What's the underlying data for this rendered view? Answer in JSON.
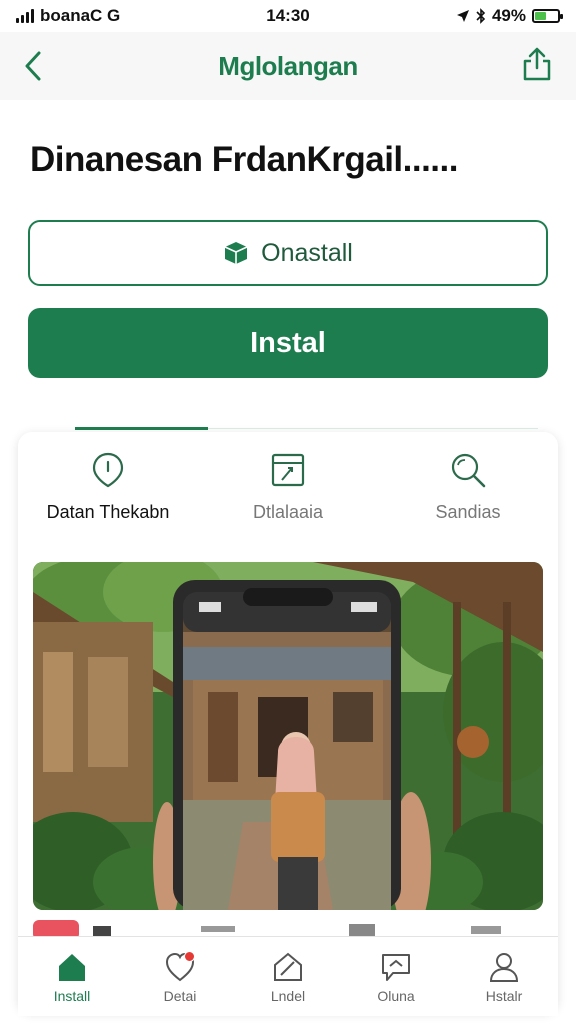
{
  "status_bar": {
    "carrier": "boanaC G",
    "time": "14:30",
    "battery_text": "49%",
    "battery_level": 0.49,
    "battery_color": "#4cc04a"
  },
  "header": {
    "app_name": "Mglolangan",
    "back_icon": "chevron-left-icon",
    "share_icon": "share-icon"
  },
  "page": {
    "title": "Dinanesan FrdanKrgail......"
  },
  "actions": {
    "secondary_label": "Onastall",
    "secondary_icon": "box-icon",
    "primary_label": "Instal"
  },
  "tabs": [
    {
      "label": "Datan Thekabn",
      "icon": "location-pin-icon",
      "active": true
    },
    {
      "label": "Dtlalaaia",
      "icon": "notebook-icon",
      "active": false
    },
    {
      "label": "Sandias",
      "icon": "search-icon",
      "active": false
    }
  ],
  "bottom_nav": [
    {
      "label": "Install",
      "icon": "home-icon",
      "active": true
    },
    {
      "label": "Detai",
      "icon": "heart-badge-icon",
      "active": false
    },
    {
      "label": "Lndel",
      "icon": "edit-icon",
      "active": false
    },
    {
      "label": "Oluna",
      "icon": "chat-icon",
      "active": false
    },
    {
      "label": "Hstalr",
      "icon": "profile-icon",
      "active": false
    }
  ],
  "colors": {
    "brand_green": "#1e7d4f",
    "badge_red": "#e53935"
  }
}
